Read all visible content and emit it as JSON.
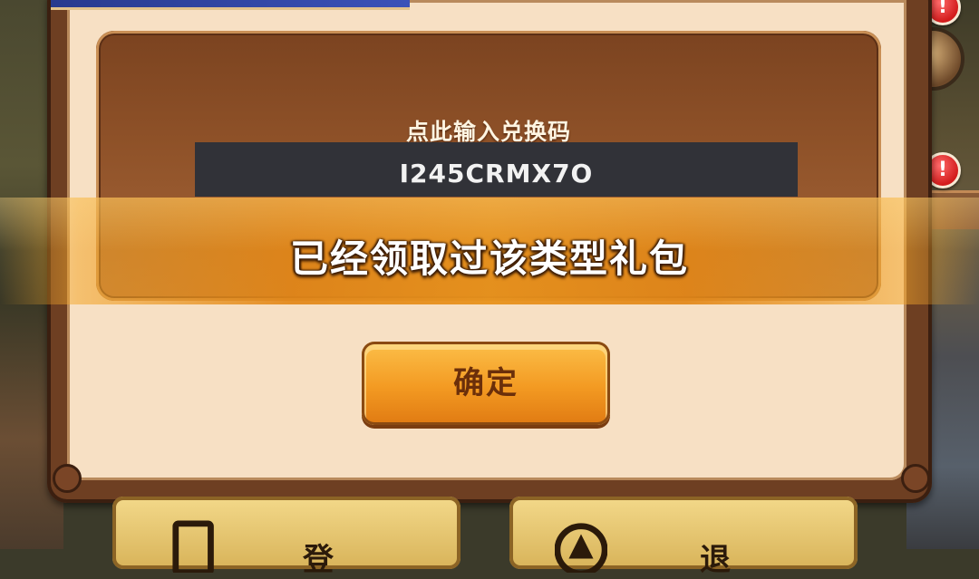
{
  "redeem_dialog": {
    "input_label": "点此输入兑换码",
    "code_value": "I245CRMX7O",
    "toast_message": "已经领取过该类型礼包",
    "confirm_label": "确定"
  },
  "background": {
    "alert_badge": "!"
  },
  "bottom_menu": {
    "left_label": "登",
    "right_label": "退"
  },
  "colors": {
    "frame": "#6e3f22",
    "panel": "#8e5128",
    "toast": "#e8921c",
    "button": "#f39a22",
    "input_bg": "#313238"
  }
}
